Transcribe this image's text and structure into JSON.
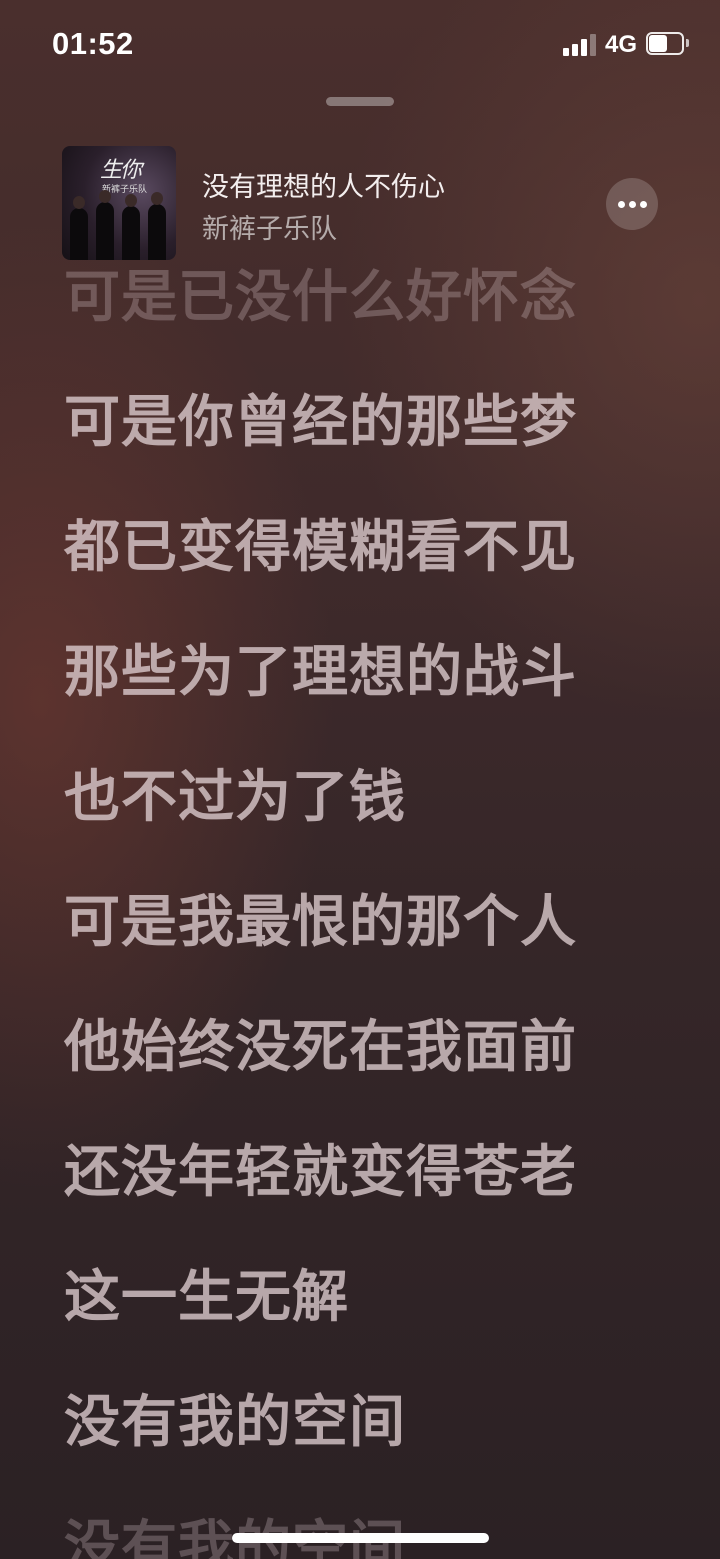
{
  "status_bar": {
    "time": "01:52",
    "network": "4G",
    "battery_percent": 60
  },
  "now_playing": {
    "title": "没有理想的人不伤心",
    "artist": "新裤子乐队"
  },
  "album_art": {
    "cover_text": "生你",
    "cover_subtext": "新裤子乐队"
  },
  "lyrics": [
    "可是已没什么好怀念",
    "可是你曾经的那些梦",
    "都已变得模糊看不见",
    "那些为了理想的战斗",
    "也不过为了钱",
    "可是我最恨的那个人",
    "他始终没死在我面前",
    "还没年轻就变得苍老",
    "这一生无解",
    "没有我的空间",
    "没有我的空间"
  ],
  "icons": {
    "signal": "cellular-signal-icon",
    "battery": "battery-icon",
    "more": "ellipsis-icon",
    "grabber": "sheet-grabber"
  }
}
